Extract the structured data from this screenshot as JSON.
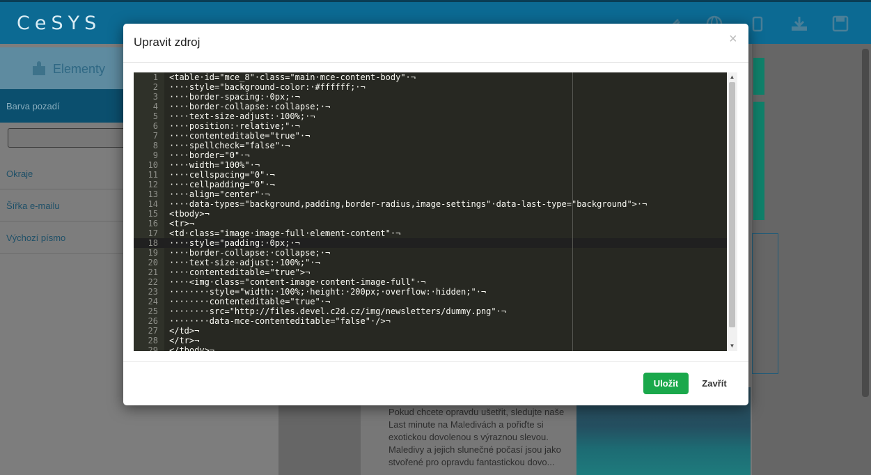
{
  "app": {
    "logo": "CeSYS"
  },
  "toolbar": {
    "icons": [
      "brush-icon",
      "globe-icon",
      "mobile-icon",
      "download-icon",
      "save-icon"
    ]
  },
  "sidebar": {
    "tab_label": "Elementy",
    "active_item": "Barva pozadí",
    "items": [
      "Okraje",
      "Šířka e-mailu",
      "Výchozí písmo"
    ]
  },
  "newsletter": {
    "paragraph": "Pokud chcete opravdu ušetřit, sledujte naše Last minute na Maledivách a pořiďte si exotickou dovolenou s výraznou slevou. Maledivy a jejich slunečné počasí jsou jako stvořené pro opravdu fantastickou dovo..."
  },
  "modal": {
    "title": "Upravit zdroj",
    "close_symbol": "×",
    "save_label": "Uložit",
    "close_label": "Zavřít",
    "active_line": 18,
    "code_lines": [
      "<table·id=\"mce_8\"·class=\"main·mce-content-body\"·¬",
      "····style=\"background-color:·#ffffff;·¬",
      "····border-spacing:·0px;·¬",
      "····border-collapse:·collapse;·¬",
      "····text-size-adjust:·100%;·¬",
      "····position:·relative;\"·¬",
      "····contenteditable=\"true\"·¬",
      "····spellcheck=\"false\"·¬",
      "····border=\"0\"·¬",
      "····width=\"100%\"·¬",
      "····cellspacing=\"0\"·¬",
      "····cellpadding=\"0\"·¬",
      "····align=\"center\"·¬",
      "····data-types=\"background,padding,border-radius,image-settings\"·data-last-type=\"background\">·¬",
      "<tbody>¬",
      "<tr>¬",
      "<td·class=\"image·image-full·element-content\"·¬",
      "····style=\"padding:·0px;·¬",
      "····border-collapse:·collapse;·¬",
      "····text-size-adjust:·100%;\"·¬",
      "····contenteditable=\"true\">¬",
      "····<img·class=\"content-image·content-image-full\"·¬",
      "········style=\"width:·100%;·height:·200px;·overflow:·hidden;\"·¬",
      "········contenteditable=\"true\"·¬",
      "········src=\"http://files.devel.c2d.cz/img/newsletters/dummy.png\"·¬",
      "········data-mce-contenteditable=\"false\"·/>¬",
      "</td>¬",
      "</tr>¬",
      "</tbody>¬"
    ]
  }
}
